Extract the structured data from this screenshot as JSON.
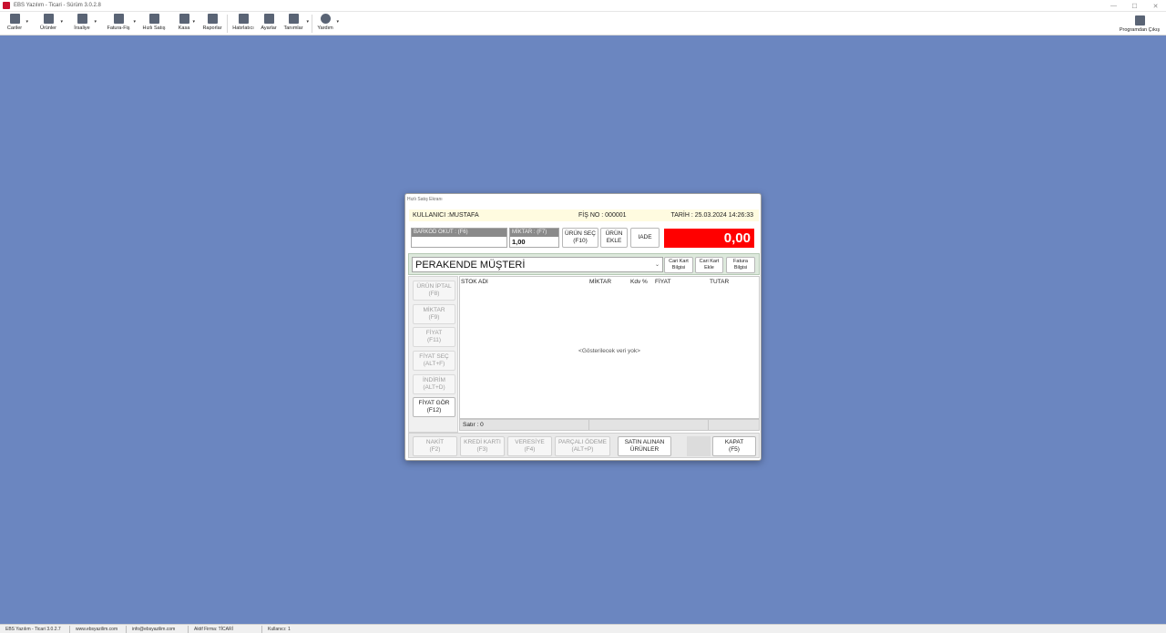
{
  "window": {
    "title": "EBS Yazılım - Ticari - Sürüm 3.0.2.8",
    "controls": [
      "—",
      "☐",
      "✕"
    ]
  },
  "toolbar": {
    "items": [
      {
        "label": "Cariler",
        "icon": "cariler-icon",
        "caret": true
      },
      {
        "label": "Ürünler",
        "icon": "urunler-icon",
        "caret": true
      },
      {
        "label": "İrsaliye",
        "icon": "irsaliye-icon",
        "caret": true
      },
      {
        "label": "Fatura-Fiş",
        "icon": "fatura-icon",
        "caret": true
      },
      {
        "label": "Hızlı Satış",
        "icon": "hizli-satis-icon",
        "caret": false
      },
      {
        "label": "Kasa",
        "icon": "kasa-icon",
        "caret": true
      },
      {
        "label": "Raporlar",
        "icon": "raporlar-icon",
        "caret": false
      },
      {
        "label": "Hatırlatıcı",
        "icon": "hatirlatici-icon",
        "caret": false
      },
      {
        "label": "Ayarlar",
        "icon": "ayarlar-icon",
        "caret": false
      },
      {
        "label": "Tanımlar",
        "icon": "tanimlar-icon",
        "caret": true
      },
      {
        "label": "Yardım",
        "icon": "yardim-icon",
        "caret": true
      }
    ],
    "exit_label": "Programdan Çıkış"
  },
  "dialog": {
    "title": "Hızlı Satış Ekranı",
    "user": "KULLANICI :MUSTAFA",
    "fis_no": "FİŞ NO : 000001",
    "tarih": "TARİH : 25.03.2024 14:26:33",
    "barkod_label": "BARKOD OKUT : (F6)",
    "barkod_value": "",
    "miktar_label": "MİKTAR : (F7)",
    "miktar_value": "1,00",
    "urun_sec": "ÜRÜN SEÇ\n(F10)",
    "urun_ekle": "ÜRÜN\nEKLE",
    "iade": "IADE",
    "total": "0,00",
    "customer": "PERAKENDE MÜŞTERİ",
    "cari_kart_bilgisi": "Cari Kart\nBilgisi",
    "cari_kart_ekle": "Cari Kart\nEkle",
    "fatura_bilgisi": "Fatura\nBilgisi",
    "side_buttons": [
      {
        "label": "ÜRÜN İPTAL\n(F8)",
        "active": false
      },
      {
        "label": "MİKTAR\n(F9)",
        "active": false
      },
      {
        "label": "FİYAT\n(F11)",
        "active": false
      },
      {
        "label": "FİYAT SEÇ\n(ALT+F)",
        "active": false
      },
      {
        "label": "İNDİRİM\n(ALT+D)",
        "active": false
      },
      {
        "label": "FİYAT GÖR\n(F12)",
        "active": true
      }
    ],
    "grid": {
      "columns": [
        "STOK ADI",
        "MİKTAR",
        "Kdv %",
        "FİYAT",
        "TUTAR"
      ],
      "empty_text": "<Gösterilecek veri yok>",
      "footer": "Satır : 0"
    },
    "bottom_buttons": [
      {
        "label": "NAKİT\n(F2)",
        "active": false
      },
      {
        "label": "KREDİ KARTI\n(F3)",
        "active": false
      },
      {
        "label": "VERESİYE\n(F4)",
        "active": false
      },
      {
        "label": "PARÇALI ÖDEME\n(ALT+P)",
        "active": false
      },
      {
        "label": "SATIN ALINAN\nÜRÜNLER",
        "active": true
      }
    ],
    "kapat": "KAPAT\n(F5)"
  },
  "statusbar": {
    "segments": [
      "EBS Yazılım - Ticari 3.0.2.7",
      "www.ebsyazilim.com",
      "info@ebsyazilim.com",
      "Aktif Firma: TİCARİ",
      "Kullanıcı: 1"
    ]
  },
  "colors": {
    "desktop": "#6b86c0",
    "total_bg": "#ff0000",
    "info_bar": "#fffbe0",
    "customer_strip": "#dde9dc"
  }
}
